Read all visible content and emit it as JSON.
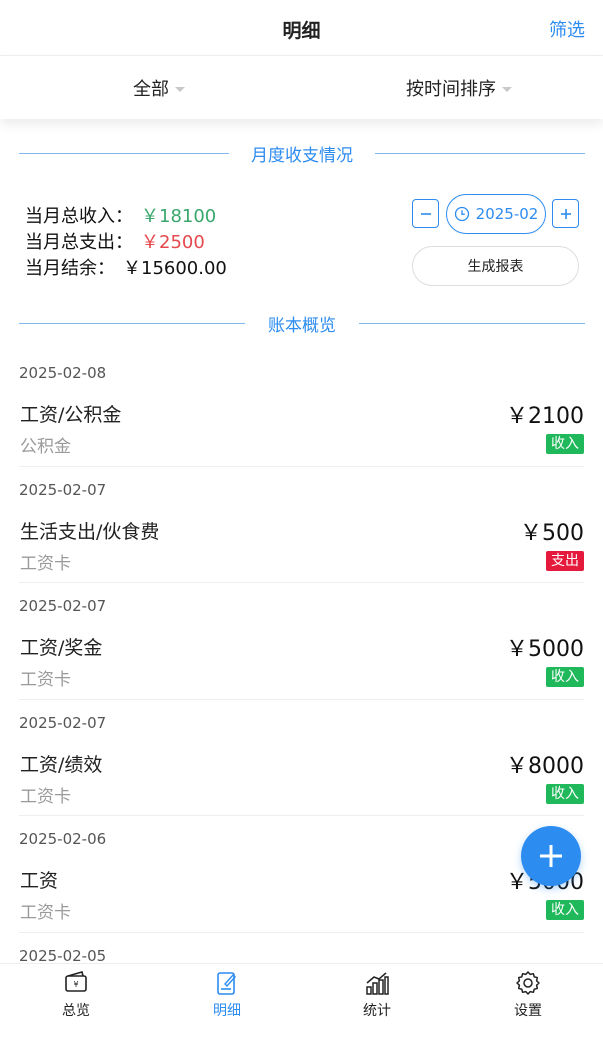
{
  "header": {
    "title": "明细",
    "filter_label": "筛选"
  },
  "filters": {
    "category": "全部",
    "sort": "按时间排序"
  },
  "sections": {
    "monthly": "月度收支情况",
    "ledger": "账本概览"
  },
  "summary": {
    "income_label": "当月总收入：",
    "income_value": "￥18100",
    "expense_label": "当月总支出：",
    "expense_value": "￥2500",
    "balance_label": "当月结余：",
    "balance_value": "￥15600.00",
    "income_color": "#3aa76d",
    "expense_color": "#e5484d"
  },
  "month_picker": {
    "value": "2025-02",
    "report_label": "生成报表"
  },
  "entries": [
    {
      "date": "2025-02-08",
      "category": "工资/公积金",
      "account": "公积金",
      "amount": "￥2100",
      "type": "收入"
    },
    {
      "date": "2025-02-07",
      "category": "生活支出/伙食费",
      "account": "工资卡",
      "amount": "￥500",
      "type": "支出"
    },
    {
      "date": "2025-02-07",
      "category": "工资/奖金",
      "account": "工资卡",
      "amount": "￥5000",
      "type": "收入"
    },
    {
      "date": "2025-02-07",
      "category": "工资/绩效",
      "account": "工资卡",
      "amount": "￥8000",
      "type": "收入"
    },
    {
      "date": "2025-02-06",
      "category": "工资",
      "account": "工资卡",
      "amount": "￥5000",
      "type": "收入"
    },
    {
      "date": "2025-02-05",
      "category": "",
      "account": "",
      "amount": "",
      "type": ""
    }
  ],
  "tabs": [
    {
      "label": "总览",
      "icon": "ledger-icon"
    },
    {
      "label": "明细",
      "icon": "edit-doc-icon"
    },
    {
      "label": "统计",
      "icon": "stats-icon"
    },
    {
      "label": "设置",
      "icon": "gear-icon"
    }
  ],
  "colors": {
    "accent": "#2d8cf0",
    "income_badge": "#1fb85b",
    "expense_badge": "#e4193b"
  }
}
